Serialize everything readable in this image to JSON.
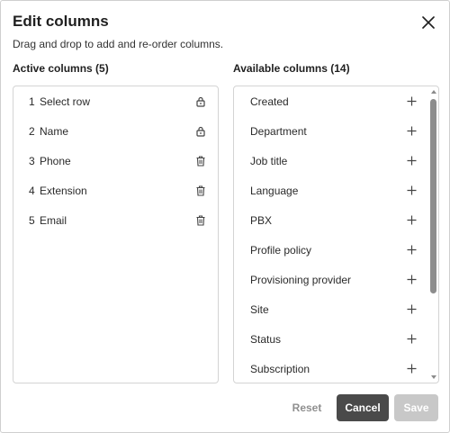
{
  "dialog": {
    "title": "Edit columns",
    "subtitle": "Drag and drop to add and re-order columns."
  },
  "active": {
    "heading": "Active columns (5)",
    "items": [
      {
        "num": "1",
        "label": "Select row",
        "icon": "lock-icon"
      },
      {
        "num": "2",
        "label": "Name",
        "icon": "lock-icon"
      },
      {
        "num": "3",
        "label": "Phone",
        "icon": "trash-icon"
      },
      {
        "num": "4",
        "label": "Extension",
        "icon": "trash-icon"
      },
      {
        "num": "5",
        "label": "Email",
        "icon": "trash-icon"
      }
    ]
  },
  "available": {
    "heading": "Available columns (14)",
    "items": [
      {
        "label": "Created",
        "icon": "plus-icon"
      },
      {
        "label": "Department",
        "icon": "plus-icon"
      },
      {
        "label": "Job title",
        "icon": "plus-icon"
      },
      {
        "label": "Language",
        "icon": "plus-icon"
      },
      {
        "label": "PBX",
        "icon": "plus-icon"
      },
      {
        "label": "Profile policy",
        "icon": "plus-icon"
      },
      {
        "label": "Provisioning provider",
        "icon": "plus-icon"
      },
      {
        "label": "Site",
        "icon": "plus-icon"
      },
      {
        "label": "Status",
        "icon": "plus-icon"
      },
      {
        "label": "Subscription",
        "icon": "plus-icon"
      }
    ]
  },
  "footer": {
    "reset_label": "Reset",
    "cancel_label": "Cancel",
    "save_label": "Save"
  },
  "colors": {
    "primary_button": "#4a4a4a",
    "disabled_button": "#c8c8c8",
    "border": "#d4d4d4"
  }
}
